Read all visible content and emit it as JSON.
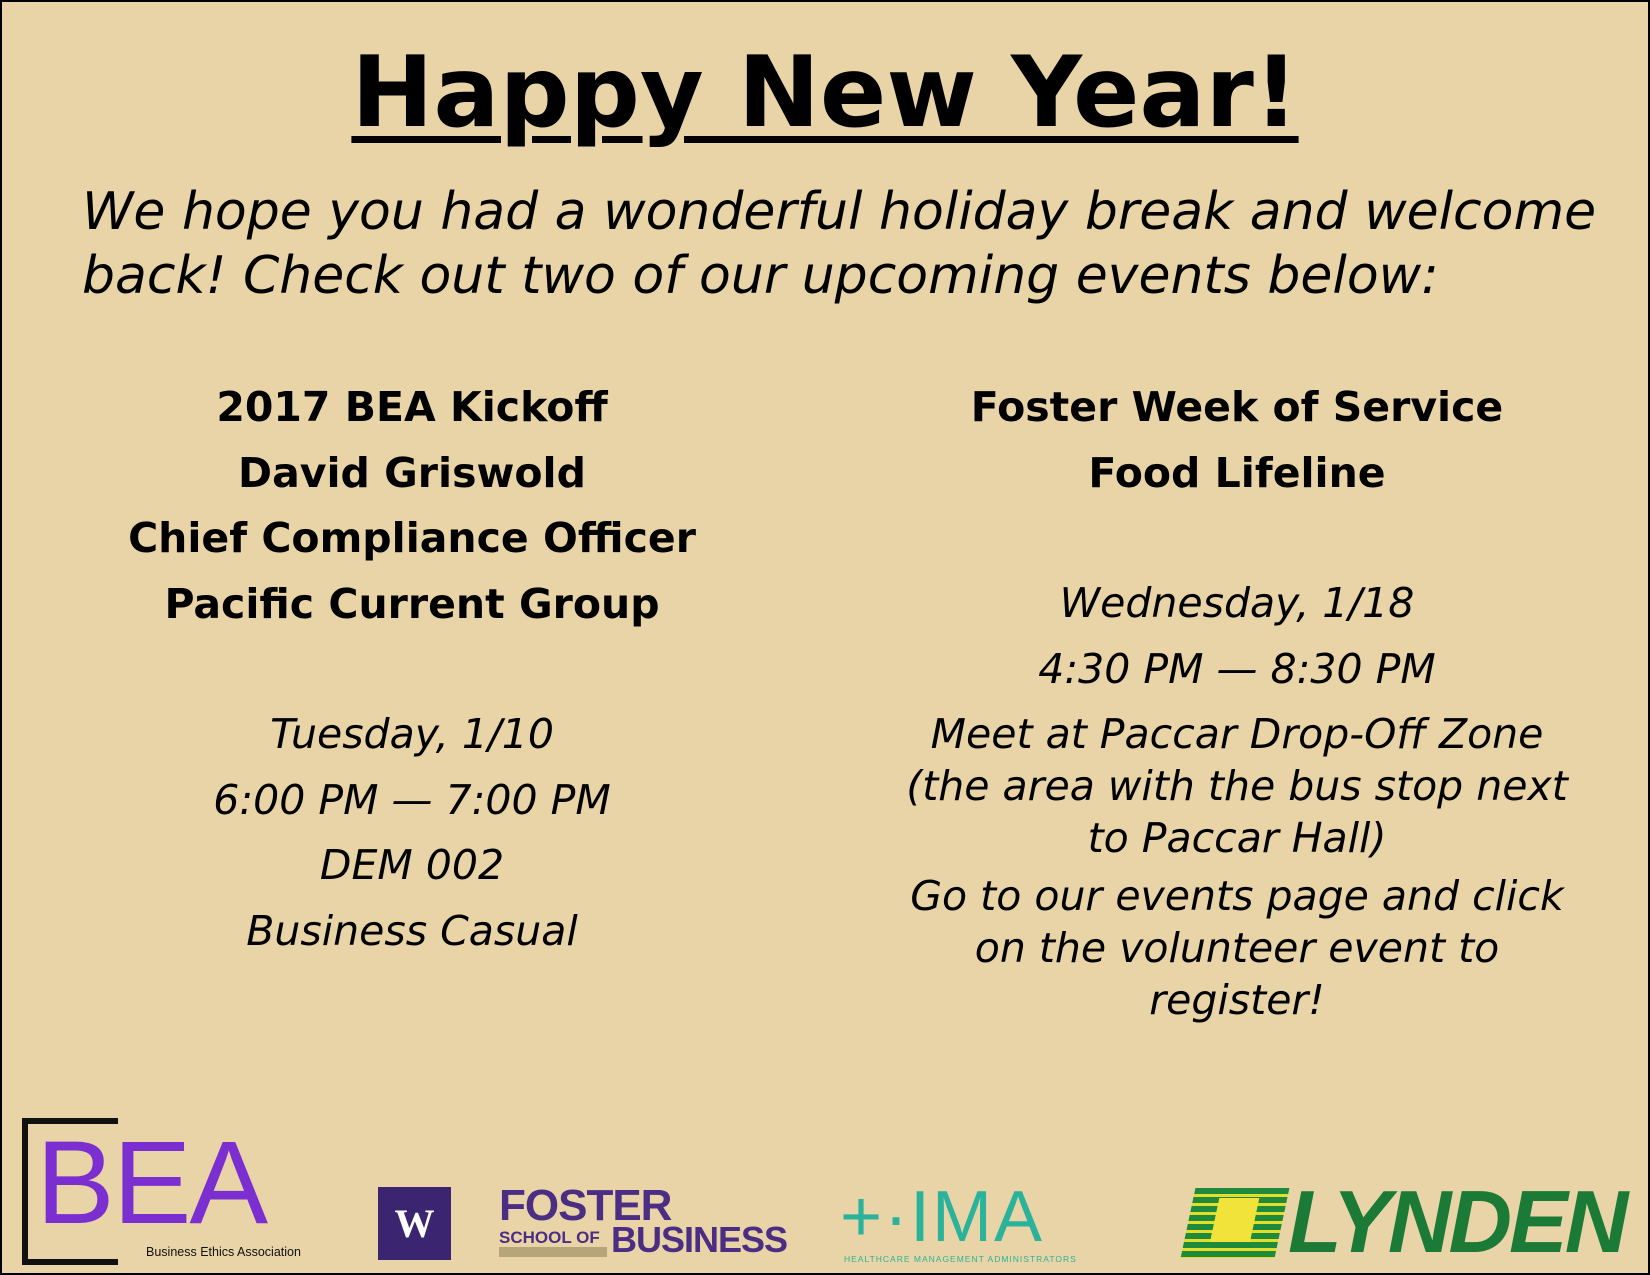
{
  "title": "Happy New Year!",
  "intro": "We hope you had a wonderful holiday break and welcome back! Check out two of our upcoming events below:",
  "events": [
    {
      "heading": [
        "2017 BEA Kickoff",
        "David Griswold",
        "Chief Compliance Officer",
        "Pacific Current Group"
      ],
      "details": [
        "Tuesday, 1/10",
        "6:00 PM — 7:00 PM",
        "DEM 002",
        "Business Casual"
      ]
    },
    {
      "heading": [
        "Foster Week of Service",
        "Food Lifeline"
      ],
      "details": [
        "Wednesday, 1/18",
        "4:30 PM — 8:30 PM",
        "Meet at Paccar Drop-Off Zone (the area with the bus stop next to Paccar Hall)",
        "Go to our events page and click on the volunteer event to register!"
      ]
    }
  ],
  "logos": {
    "bea_letters": "BEA",
    "bea_sub": "Business Ethics Association",
    "uw_letter": "W",
    "foster_line1": "FOSTER",
    "foster_line2": "SCHOOL OF",
    "foster_line3": "BUSINESS",
    "hma_mark": "+·IMA",
    "hma_sub": "HEALTHCARE MANAGEMENT ADMINISTRATORS",
    "lynden_word": "LYNDEN"
  },
  "colors": {
    "background": "#e8d4a6",
    "bea_purple": "#7b2fd0",
    "uw_purple": "#4b2e83",
    "hma_teal": "#2ab39a",
    "lynden_green": "#1a7a36"
  }
}
